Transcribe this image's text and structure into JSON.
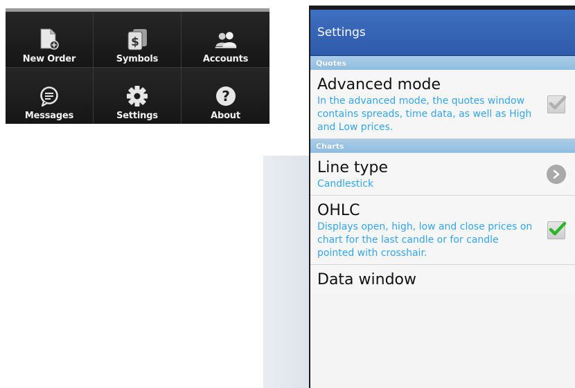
{
  "menu": {
    "items": [
      {
        "label": "New Order",
        "icon": "new-order-icon"
      },
      {
        "label": "Symbols",
        "icon": "symbols-icon"
      },
      {
        "label": "Accounts",
        "icon": "accounts-icon"
      },
      {
        "label": "Messages",
        "icon": "messages-icon"
      },
      {
        "label": "Settings",
        "icon": "settings-icon"
      },
      {
        "label": "About",
        "icon": "about-icon"
      }
    ]
  },
  "settings": {
    "title": "Settings",
    "sections": [
      {
        "header": "Quotes",
        "prefs": [
          {
            "title": "Advanced mode",
            "summary": "In the advanced mode, the quotes window contains spreads, time data, as well as High and Low prices.",
            "widget": "checkbox",
            "checked": true,
            "enabled": false
          }
        ]
      },
      {
        "header": "Charts",
        "prefs": [
          {
            "title": "Line type",
            "summary": "Candlestick",
            "widget": "arrow"
          },
          {
            "title": "OHLC",
            "summary": "Displays open, high, low and close prices on chart for the last candle or for candle pointed with crosshair.",
            "widget": "checkbox",
            "checked": true,
            "enabled": true
          },
          {
            "title": "Data window",
            "summary": "",
            "widget": "none"
          }
        ]
      }
    ]
  },
  "colors": {
    "titlebar": "#3a67b8",
    "section_header": "#9cc6e6",
    "summary_text": "#35a4e8",
    "check_active": "#2bb52b",
    "check_inactive": "#b0b0b0"
  }
}
